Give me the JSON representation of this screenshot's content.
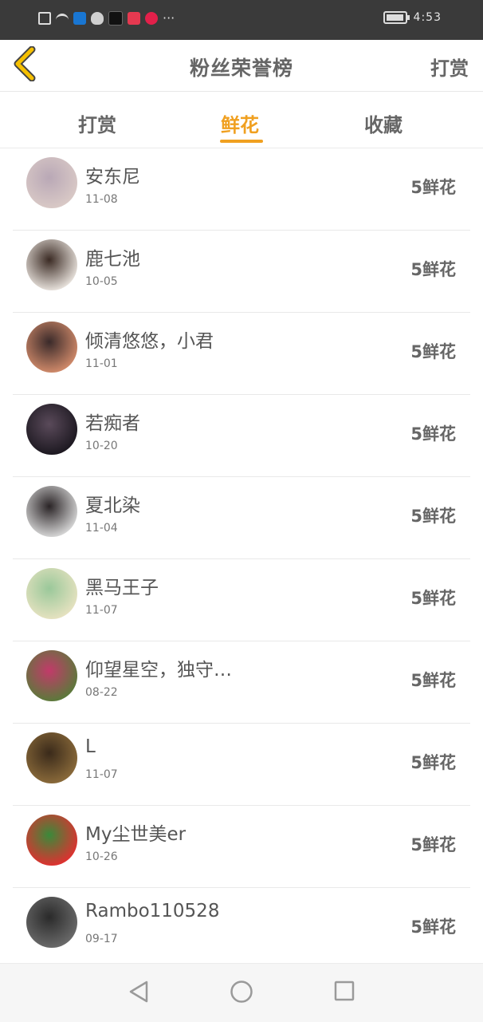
{
  "status_bar": {
    "time": "4:53",
    "more": "···"
  },
  "header": {
    "title": "粉丝荣誉榜",
    "action_label": "打赏"
  },
  "tabs": [
    {
      "label": "打赏"
    },
    {
      "label": "鲜花"
    },
    {
      "label": "收藏"
    }
  ],
  "active_tab": "鲜花",
  "colors": {
    "accent": "#f0a020",
    "back_chevron": "#f6c000"
  },
  "fans": [
    {
      "name": "安东尼",
      "date": "11-08",
      "gift": "5鲜花",
      "avatar_colors": [
        "#d9c9c6",
        "#b9a8b6"
      ]
    },
    {
      "name": "鹿七池",
      "date": "10-05",
      "gift": "5鲜花",
      "avatar_colors": [
        "#e8e2dc",
        "#3b2b24"
      ]
    },
    {
      "name": "倾清悠悠，小君",
      "date": "11-01",
      "gift": "5鲜花",
      "avatar_colors": [
        "#d08a6a",
        "#3a2a2a"
      ]
    },
    {
      "name": "若痴者",
      "date": "10-20",
      "gift": "5鲜花",
      "avatar_colors": [
        "#1c1820",
        "#5a4a5a"
      ]
    },
    {
      "name": "夏北染",
      "date": "11-04",
      "gift": "5鲜花",
      "avatar_colors": [
        "#d6d6d6",
        "#2a2426"
      ]
    },
    {
      "name": "黑马王子",
      "date": "11-07",
      "gift": "5鲜花",
      "avatar_colors": [
        "#e6e2c0",
        "#9ac89a"
      ]
    },
    {
      "name": "仰望星空，独守…",
      "date": "08-22",
      "gift": "5鲜花",
      "avatar_colors": [
        "#5a7a3a",
        "#c23a6a"
      ]
    },
    {
      "name": "L",
      "date": "11-07",
      "gift": "5鲜花",
      "avatar_colors": [
        "#8a6a3a",
        "#3a2a1a"
      ]
    },
    {
      "name": "My尘世美er",
      "date": "10-26",
      "gift": "5鲜花",
      "avatar_colors": [
        "#e03030",
        "#3a8a3a"
      ]
    },
    {
      "name": "Rambo110528",
      "date": "09-17",
      "gift": "5鲜花",
      "avatar_colors": [
        "#6a6a6a",
        "#2a2a2a"
      ]
    }
  ]
}
